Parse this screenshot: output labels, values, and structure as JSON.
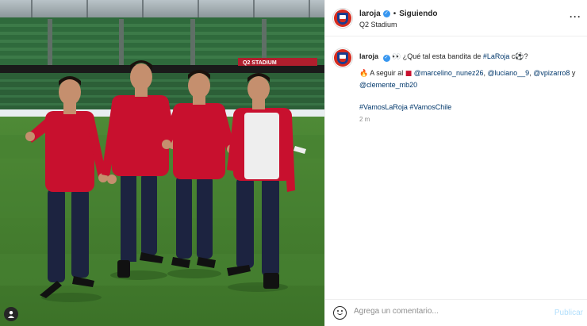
{
  "post": {
    "image_alt": "",
    "stadium_banner": "Q2 STADIUM"
  },
  "header": {
    "username": "laroja",
    "verified_glyph": "✓",
    "separator": "•",
    "follow_status": "Siguiendo",
    "location": "Q2 Stadium",
    "more_glyph": "···"
  },
  "caption": {
    "username": "laroja",
    "verified_glyph": "✓",
    "eyes_emoji": "👀",
    "line1_text": " ¿Qué tal esta bandita de ",
    "hashtag_laroja": "#LaRoja",
    "line1_end": " c",
    "ball_emoji": "⚽",
    "line1_q": "?",
    "fire_emoji": "🔥",
    "line2_text": " A seguir al ",
    "flag_emoji": "■",
    "mention1": "@marcelino_nunez26",
    "sep1": ", ",
    "mention2": "@luciano__9",
    "sep2": ", ",
    "mention3": "@vpizarro8",
    "and": " y ",
    "mention4": "@clemente_mb20",
    "hashtag1": "#VamosLaRoja",
    "hashtag_space": " ",
    "hashtag2": "#VamosChile",
    "time": "2 m"
  },
  "comment_box": {
    "placeholder": "Agrega un comentario...",
    "publish_label": "Publicar"
  },
  "colors": {
    "accent_blue": "#3897f0",
    "link": "#00376b",
    "publish_disabled": "#b2dffc",
    "jersey_red": "#c8102e",
    "pants_navy": "#1c2340"
  },
  "icons": {
    "verified": "verified-badge-icon",
    "more": "more-options-icon",
    "smile": "emoji-smile-icon",
    "tag": "user-tag-icon"
  }
}
